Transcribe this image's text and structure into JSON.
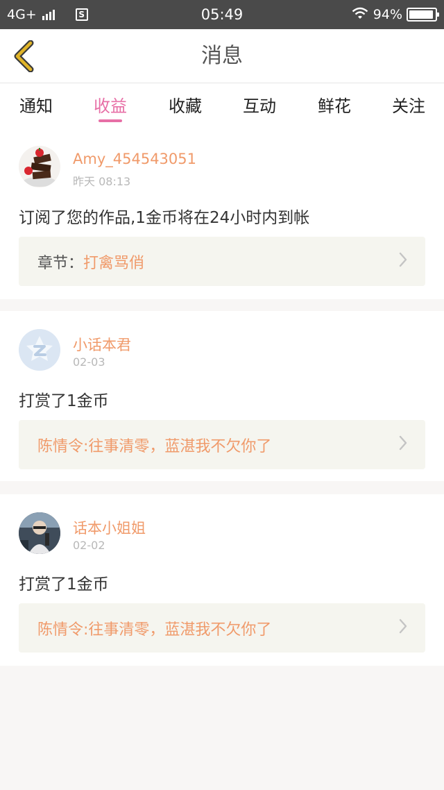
{
  "status_bar": {
    "network": "4G+",
    "sim_icon": "S",
    "time": "05:49",
    "battery_percent": "94%",
    "battery_level": 0.94,
    "icons": [
      "signal-icon",
      "sim-icon",
      "wifi-icon",
      "battery-icon"
    ]
  },
  "header": {
    "title": "消息",
    "back_icon": "chevron-left-icon"
  },
  "tabs": [
    {
      "label": "通知",
      "active": false
    },
    {
      "label": "收益",
      "active": true
    },
    {
      "label": "收藏",
      "active": false
    },
    {
      "label": "互动",
      "active": false
    },
    {
      "label": "鲜花",
      "active": false
    },
    {
      "label": "关注",
      "active": false
    }
  ],
  "messages": [
    {
      "username": "Amy_454543051",
      "time": "昨天 08:13",
      "text": "订阅了您的作品,1金币将在24小时内到帐",
      "link_prefix": "章节：",
      "link_text": "打禽骂俏"
    },
    {
      "username": "小话本君",
      "time": "02-03",
      "text": "打赏了1金币",
      "link_prefix": "",
      "link_text": "陈情令:往事清零，蓝湛我不欠你了"
    },
    {
      "username": "话本小姐姐",
      "time": "02-02",
      "text": "打赏了1金币",
      "link_prefix": "",
      "link_text": "陈情令:往事清零，蓝湛我不欠你了"
    }
  ],
  "colors": {
    "accent_pink": "#e76fa6",
    "accent_orange": "#f09a6a",
    "back_arrow": "#e0b428",
    "status_bar_bg": "#4a4a4a"
  }
}
